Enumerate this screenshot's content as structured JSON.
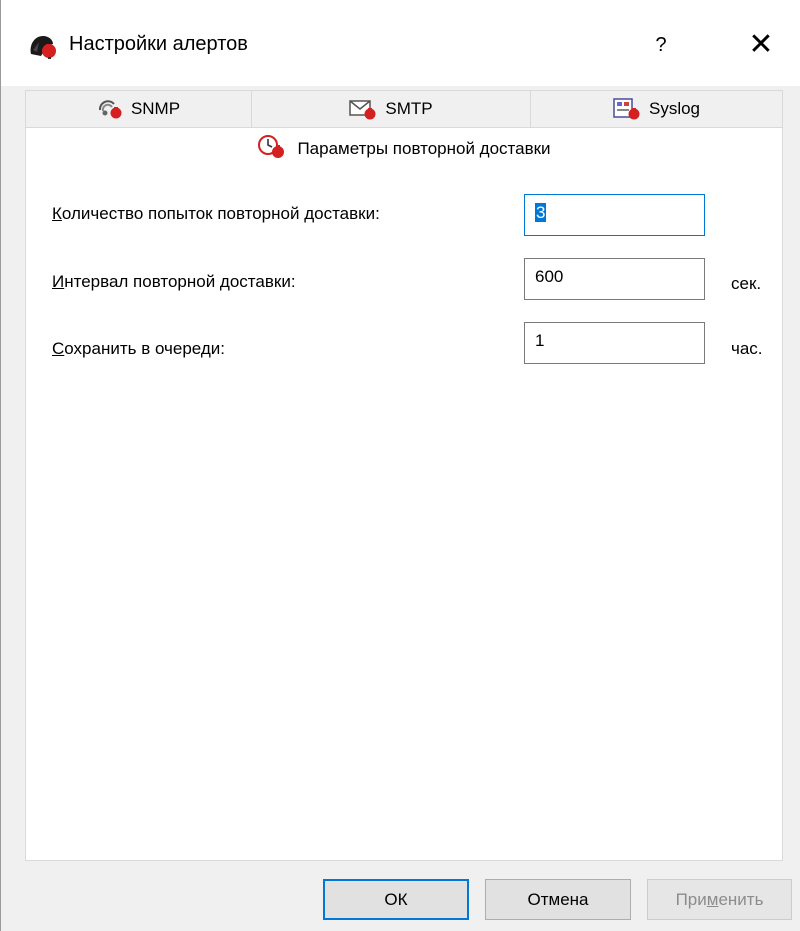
{
  "window": {
    "title": "Настройки алертов",
    "help": "?",
    "close": "✕"
  },
  "tabs": [
    {
      "label": "SNMP",
      "icon": "snmp-icon"
    },
    {
      "label": "SMTP",
      "icon": "mail-icon"
    },
    {
      "label": "Syslog",
      "icon": "syslog-icon"
    }
  ],
  "active_tab": {
    "label": "Параметры повторной доставки",
    "icon": "clock-icon"
  },
  "fields": {
    "retry_count": {
      "label_first": "К",
      "label_rest": "оличество попыток повторной доставки:",
      "value": "3"
    },
    "retry_interval": {
      "label_first": "И",
      "label_rest": "нтервал повторной доставки:",
      "value": "600",
      "unit": "сек."
    },
    "queue_keep": {
      "label_first": "С",
      "label_rest": "охранить в очереди:",
      "value": "1",
      "unit": "час."
    }
  },
  "buttons": {
    "ok": "ОК",
    "cancel": "Отмена",
    "apply_pre": "При",
    "apply_u": "м",
    "apply_post": "енить"
  },
  "colors": {
    "accent": "#0078d7",
    "alert_red": "#d42020"
  }
}
